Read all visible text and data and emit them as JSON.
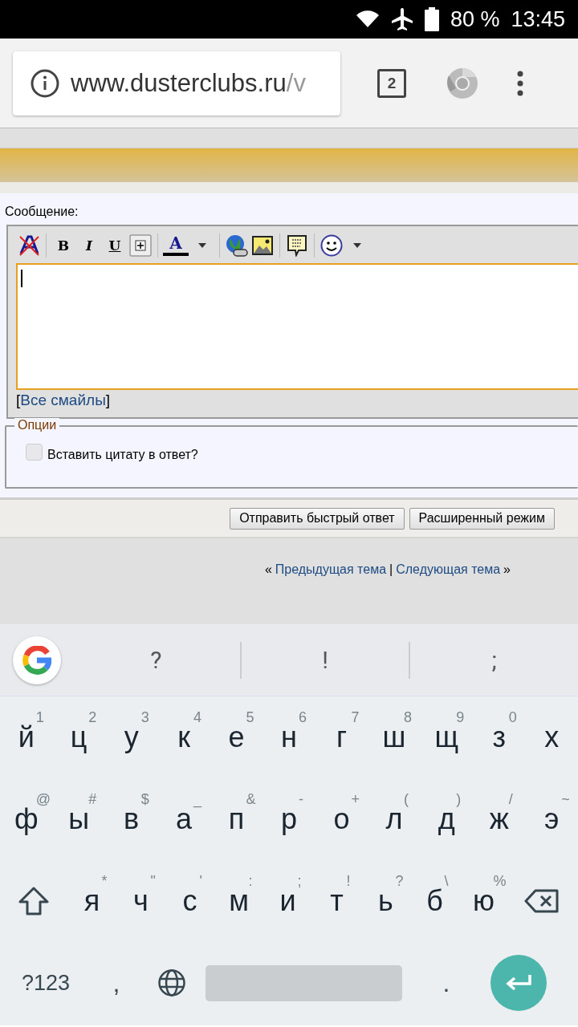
{
  "status_bar": {
    "battery": "80 %",
    "time": "13:45"
  },
  "browser": {
    "url_host": "www.dusterclubs.ru",
    "url_path": "/v",
    "tab_count": "2"
  },
  "reply_form": {
    "label": "Сообщение:",
    "format_buttons": [
      "B",
      "I",
      "U"
    ],
    "font_color_label": "A",
    "smilies_open": "[",
    "smilies_link": "Все смайлы",
    "smilies_close": "]",
    "options_legend": "Опции",
    "quote_option": {
      "label": "Вставить цитату в ответ?",
      "checked": false
    },
    "buttons": [
      "Отправить быстрый ответ",
      "Расширенный режим"
    ]
  },
  "thread_nav": {
    "open": "«",
    "previous": "Предыдущая тема",
    "separator": "|",
    "next": "Следующая тема",
    "close": "»"
  },
  "keyboard": {
    "suggestions": [
      "?",
      "!",
      ";"
    ],
    "rows": [
      [
        {
          "key": "й",
          "hint": "1"
        },
        {
          "key": "ц",
          "hint": "2"
        },
        {
          "key": "у",
          "hint": "3"
        },
        {
          "key": "к",
          "hint": "4"
        },
        {
          "key": "е",
          "hint": "5"
        },
        {
          "key": "н",
          "hint": "6"
        },
        {
          "key": "г",
          "hint": "7"
        },
        {
          "key": "ш",
          "hint": "8"
        },
        {
          "key": "щ",
          "hint": "9"
        },
        {
          "key": "з",
          "hint": "0"
        },
        {
          "key": "х"
        }
      ],
      [
        {
          "key": "ф",
          "hint": "@"
        },
        {
          "key": "ы",
          "hint": "#"
        },
        {
          "key": "в",
          "hint": "$"
        },
        {
          "key": "а",
          "hint": "_"
        },
        {
          "key": "п",
          "hint": "&"
        },
        {
          "key": "р",
          "hint": "-"
        },
        {
          "key": "о",
          "hint": "+"
        },
        {
          "key": "л",
          "hint": "("
        },
        {
          "key": "д",
          "hint": ")"
        },
        {
          "key": "ж",
          "hint": "/"
        },
        {
          "key": "э",
          "hint": "~"
        }
      ],
      [
        {
          "kind": "shift"
        },
        {
          "key": "я",
          "hint": "*"
        },
        {
          "key": "ч",
          "hint": "\""
        },
        {
          "key": "с",
          "hint": "'"
        },
        {
          "key": "м",
          "hint": ":"
        },
        {
          "key": "и",
          "hint": ";"
        },
        {
          "key": "т",
          "hint": "!"
        },
        {
          "key": "ь",
          "hint": "?"
        },
        {
          "key": "б",
          "hint": "\\"
        },
        {
          "key": "ю",
          "hint": "%"
        },
        {
          "kind": "backspace"
        }
      ]
    ],
    "symbols_key": "?123",
    "comma_key": ",",
    "period_key": "."
  }
}
